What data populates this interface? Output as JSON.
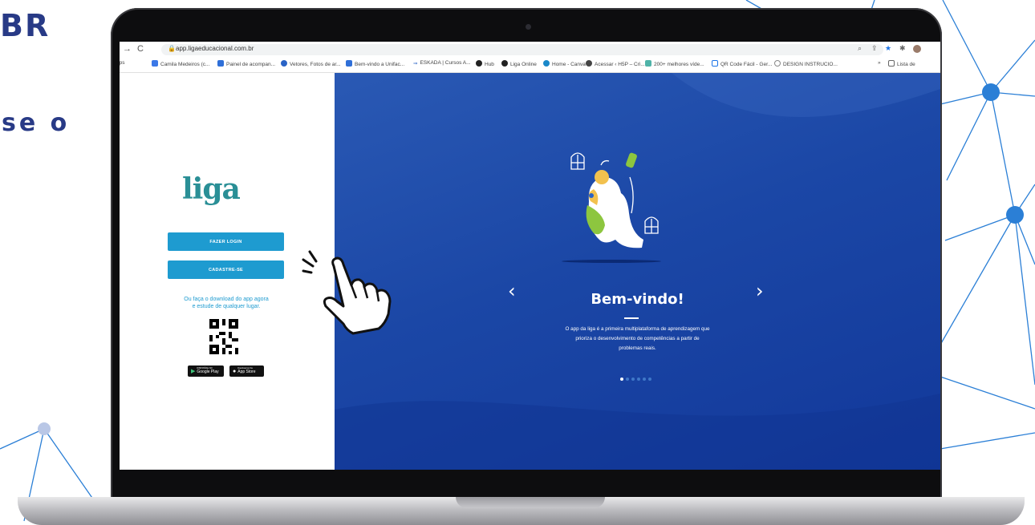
{
  "background": {
    "heading_fragment": "BR",
    "text_fragment": "se o",
    "accent_color": "#283a86",
    "network_color": "#2b7fd6"
  },
  "browser": {
    "url": "app.ligaeducacional.com.br",
    "bookmarks": [
      {
        "label": "pps",
        "icon": "apps-icon"
      },
      {
        "label": "Camila Medeiros (c...",
        "icon": "profile-icon"
      },
      {
        "label": "Painel de acompan...",
        "icon": "page-icon"
      },
      {
        "label": "Vetores, Fotos de ar...",
        "icon": "freepik-icon"
      },
      {
        "label": "Bem-vindo a Unifac...",
        "icon": "page-icon"
      },
      {
        "label": "ESKADA | Cursos A...",
        "icon": "eskada-icon"
      },
      {
        "label": "Hub",
        "icon": "hub-icon"
      },
      {
        "label": "Liga Online",
        "icon": "liga-icon"
      },
      {
        "label": "Home - Canva",
        "icon": "canva-icon"
      },
      {
        "label": "Acessar ‹ H5P – Cri...",
        "icon": "wordpress-icon"
      },
      {
        "label": "200+ melhores víde...",
        "icon": "video-icon"
      },
      {
        "label": "QR Code Fácil - Ger...",
        "icon": "qr-icon"
      },
      {
        "label": "DESIGN INSTRUCIO...",
        "icon": "globe-icon"
      },
      {
        "label": "Lista de",
        "icon": "list-icon"
      }
    ]
  },
  "login_panel": {
    "logo": "liga",
    "login_button": "FAZER LOGIN",
    "register_button": "CADASTRE-SE",
    "download_line1": "Ou faça o download do app agora",
    "download_line2": "e estude de qualquer lugar.",
    "google_play_small": "DISPONÍVEL NO",
    "google_play": "Google Play",
    "app_store_small": "Download on the",
    "app_store": "App Store"
  },
  "carousel": {
    "title": "Bem-vindo!",
    "description_line1": "O app da liga é a primeira multiplataforma de aprendizagem que",
    "description_line2": "prioriza o desenvolvimento de competências a partir de",
    "description_line3": "problemas reais.",
    "prev_arrow": "‹",
    "next_arrow": "›",
    "slide_count": 6,
    "active_slide": 1
  }
}
